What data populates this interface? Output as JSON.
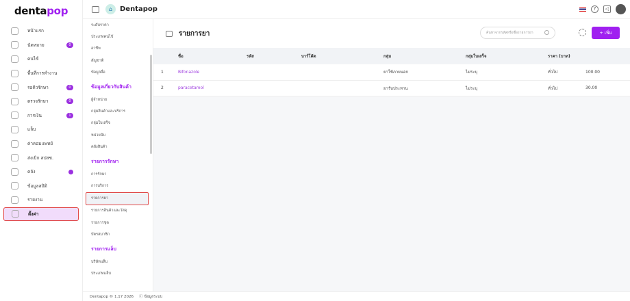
{
  "logo": {
    "text_a": "denta",
    "text_b": "pop"
  },
  "sidebar": {
    "items": [
      {
        "label": "หน้าแรก",
        "icon": "home-icon"
      },
      {
        "label": "นัดหมาย",
        "icon": "calendar-icon",
        "badge": "0"
      },
      {
        "label": "คนไข้",
        "icon": "user-icon"
      },
      {
        "label": "พื้นที่การทำงาน",
        "icon": "workspace-icon"
      },
      {
        "label": "รอคิวรักษา",
        "icon": "dental-chair-icon",
        "badge": "0"
      },
      {
        "label": "ตรวจรักษา",
        "icon": "tools-icon",
        "badge": "0"
      },
      {
        "label": "การเงิน",
        "icon": "money-icon",
        "badge": "1"
      },
      {
        "label": "แล็บ",
        "icon": "tooth-icon"
      },
      {
        "label": "ค่าคอมแพทย์",
        "icon": "percent-icon"
      },
      {
        "label": "ส่งเบิก สปสช.",
        "icon": "cloud-icon"
      },
      {
        "label": "คลัง",
        "icon": "box-icon",
        "dot": true
      },
      {
        "label": "ข้อมูลสถิติ",
        "icon": "stats-icon"
      },
      {
        "label": "รายงาน",
        "icon": "report-icon"
      },
      {
        "label": "ตั้งค่า",
        "icon": "gear-icon",
        "active": true
      }
    ]
  },
  "topbar": {
    "brand": "Dentapop",
    "language": "th-flag"
  },
  "submenu": [
    {
      "type": "item",
      "label": "ระดับราคา"
    },
    {
      "type": "item",
      "label": "ประเภทคนไข้"
    },
    {
      "type": "item",
      "label": "อาชีพ"
    },
    {
      "type": "item",
      "label": "สัญชาติ"
    },
    {
      "type": "item",
      "label": "ข้อมูลสื่อ"
    },
    {
      "type": "head",
      "label": "ข้อมูลเกี่ยวกับสินค้า"
    },
    {
      "type": "item",
      "label": "ผู้จำหน่าย"
    },
    {
      "type": "item",
      "label": "กลุ่มสินค้าและบริการ"
    },
    {
      "type": "item",
      "label": "กลุ่มใบเสร็จ"
    },
    {
      "type": "item",
      "label": "หน่วยนับ"
    },
    {
      "type": "item",
      "label": "คลังสินค้า"
    },
    {
      "type": "head",
      "label": "รายการรักษา"
    },
    {
      "type": "item",
      "label": "การรักษา"
    },
    {
      "type": "item",
      "label": "การบริการ"
    },
    {
      "type": "item",
      "label": "รายการยา",
      "active": true
    },
    {
      "type": "item",
      "label": "รายการสินค้าและวัสดุ"
    },
    {
      "type": "item",
      "label": "รายการชุด"
    },
    {
      "type": "item",
      "label": "บัตรสมาชิก"
    },
    {
      "type": "head",
      "label": "รายการแล็บ"
    },
    {
      "type": "item",
      "label": "บริษัทแล็บ"
    },
    {
      "type": "item",
      "label": "ประเภทแล็บ"
    }
  ],
  "main": {
    "title": "รายการยา",
    "search_placeholder": "ค้นหาจากรหัสหรือชื่อรายการยา",
    "add_label": "+ เพิ่ม",
    "columns": [
      "",
      "ชื่อ",
      "รหัส",
      "บาร์โค้ด",
      "กลุ่ม",
      "กลุ่มใบเสร็จ",
      "ราคา (บาท)",
      ""
    ],
    "rows": [
      [
        "1",
        "Bifonazole",
        "",
        "",
        "ยาใช้ภายนอก",
        "ไม่ระบุ",
        "ทั่วไป",
        "100.00"
      ],
      [
        "2",
        "paracetamol",
        "",
        "",
        "ยารับประทาน",
        "ไม่ระบุ",
        "ทั่วไป",
        "30.00"
      ]
    ]
  },
  "footer": {
    "version": "Dentapop © 1.17 2026",
    "info": "ⓘ ข้อมูลระบบ"
  },
  "colors": {
    "accent": "#a020f0",
    "highlight": "#e04545"
  }
}
